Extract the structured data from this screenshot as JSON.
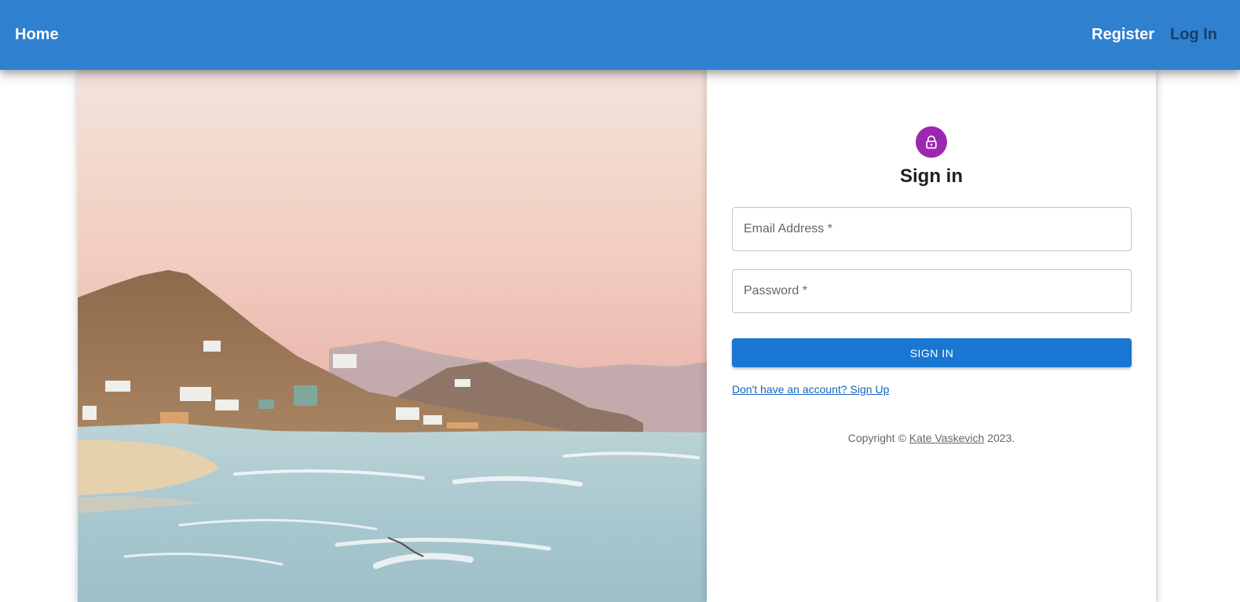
{
  "nav": {
    "home": "Home",
    "register": "Register",
    "login": "Log In"
  },
  "form": {
    "icon": "lock-icon",
    "title": "Sign in",
    "email_label": "Email Address *",
    "password_label": "Password *",
    "submit_label": "SIGN IN",
    "signup_link": "Don't have an account? Sign Up"
  },
  "footer": {
    "prefix": "Copyright © ",
    "author": "Kate Vaskevich",
    "suffix": " 2023."
  },
  "colors": {
    "appbar": "#2f80cf",
    "button": "#1976d2",
    "avatar": "#9c27b0"
  }
}
